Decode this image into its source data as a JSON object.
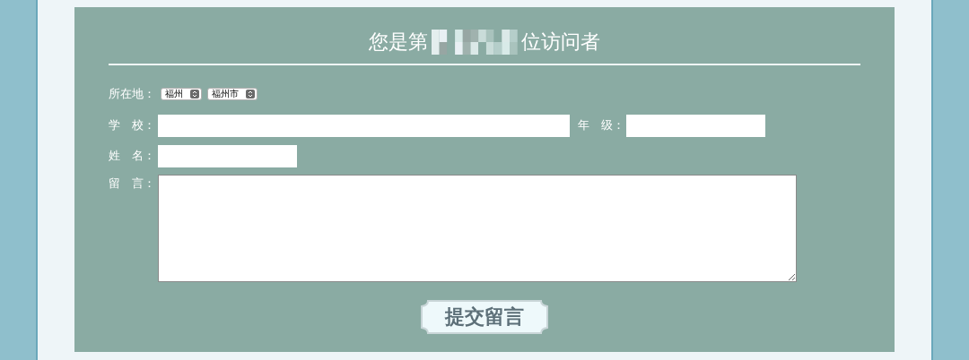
{
  "title": {
    "before": "您是第",
    "after": "位访问者"
  },
  "location": {
    "label": "所在地：",
    "province": "福州",
    "city": "福州市"
  },
  "school": {
    "label": "学　校："
  },
  "grade": {
    "label": "年　级："
  },
  "name": {
    "label": "姓　名："
  },
  "message": {
    "label": "留　言："
  },
  "submit": "提交留言"
}
